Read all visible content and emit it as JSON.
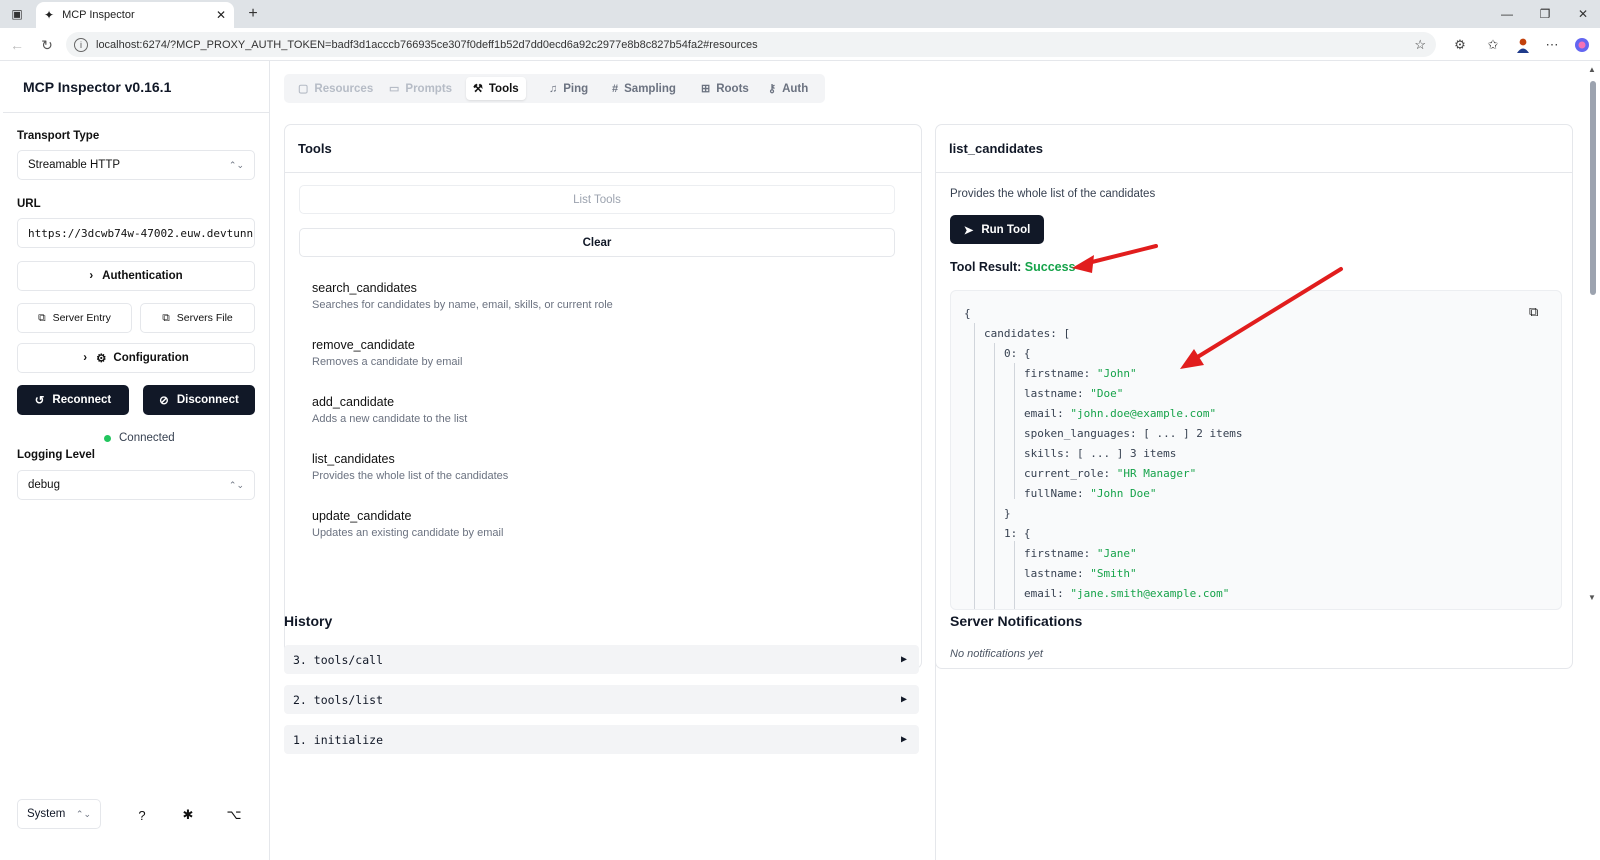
{
  "browser": {
    "tab_title": "MCP Inspector",
    "url": "localhost:6274/?MCP_PROXY_AUTH_TOKEN=badf3d1acccb766935ce307f0deff1b52d7dd0ecd6a92c2977e8b8c827b54fa2#resources",
    "minimize": "—",
    "restore": "❐",
    "close": "✕"
  },
  "sidebar": {
    "title": "MCP Inspector v0.16.1",
    "transport_label": "Transport Type",
    "transport_value": "Streamable HTTP",
    "url_label": "URL",
    "url_value": "https://3dcwb74w-47002.euw.devtunn",
    "authentication": "Authentication",
    "server_entry": "Server Entry",
    "servers_file": "Servers File",
    "configuration": "Configuration",
    "reconnect": "Reconnect",
    "disconnect": "Disconnect",
    "status": "Connected",
    "logging_label": "Logging Level",
    "logging_value": "debug",
    "theme_value": "System"
  },
  "tabs": [
    {
      "label": "Resources",
      "icon": "file-icon"
    },
    {
      "label": "Prompts",
      "icon": "chat-icon"
    },
    {
      "label": "Tools",
      "icon": "hammer-icon"
    },
    {
      "label": "Ping",
      "icon": "bell-icon"
    },
    {
      "label": "Sampling",
      "icon": "hash-icon"
    },
    {
      "label": "Roots",
      "icon": "folder-tree-icon"
    },
    {
      "label": "Auth",
      "icon": "key-icon"
    }
  ],
  "tools_panel": {
    "title": "Tools",
    "list_tools": "List Tools",
    "clear": "Clear",
    "items": [
      {
        "name": "search_candidates",
        "desc": "Searches for candidates by name, email, skills, or current role"
      },
      {
        "name": "remove_candidate",
        "desc": "Removes a candidate by email"
      },
      {
        "name": "add_candidate",
        "desc": "Adds a new candidate to the list"
      },
      {
        "name": "list_candidates",
        "desc": "Provides the whole list of the candidates"
      },
      {
        "name": "update_candidate",
        "desc": "Updates an existing candidate by email"
      }
    ]
  },
  "tool_detail": {
    "title": "list_candidates",
    "desc": "Provides the whole list of the candidates",
    "run": "Run Tool",
    "result_label": "Tool Result:",
    "result_status": "Success",
    "json": {
      "open": "{",
      "candidates_key": "candidates:",
      "candidates_open": "[",
      "i0": "0:",
      "i0_open": "{",
      "firstname_k": "firstname:",
      "firstname_v": "\"John\"",
      "lastname_k": "lastname:",
      "lastname_v": "\"Doe\"",
      "email_k": "email:",
      "email_v": "\"john.doe@example.com\"",
      "spoken_k": "spoken_languages:",
      "spoken_v": "[ ... ] 2 items",
      "skills_k": "skills:",
      "skills_v": "[ ... ] 3 items",
      "role_k": "current_role:",
      "role_v": "\"HR Manager\"",
      "full_k": "fullName:",
      "full_v": "\"John Doe\"",
      "i0_close": "}",
      "i1": "1:",
      "i1_open": "{",
      "firstname2_k": "firstname:",
      "firstname2_v": "\"Jane\"",
      "lastname2_k": "lastname:",
      "lastname2_v": "\"Smith\"",
      "email2_k": "email:",
      "email2_v": "\"jane.smith@example.com\""
    }
  },
  "history": {
    "title": "History",
    "items": [
      "3. tools/call",
      "2. tools/list",
      "1. initialize"
    ]
  },
  "notifications": {
    "title": "Server Notifications",
    "empty": "No notifications yet"
  },
  "colors": {
    "success": "#16a34a",
    "arrow": "#e11d1d",
    "dark_button": "#111827"
  }
}
